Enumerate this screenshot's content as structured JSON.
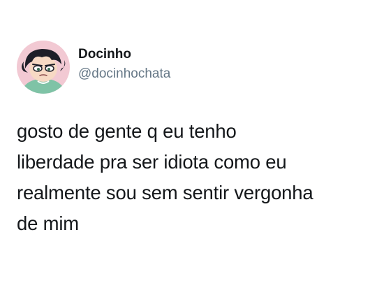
{
  "author": {
    "display_name": "Docinho",
    "handle": "@docinhochata",
    "avatar_icon": "cartoon-girl-avatar"
  },
  "tweet": {
    "lines": [
      "gosto de gente q eu tenho",
      "liberdade pra ser idiota como eu",
      "realmente sou sem sentir vergonha",
      "de mim"
    ]
  },
  "colors": {
    "background": "#ffffff",
    "text": "#14171a",
    "handle": "#657786"
  }
}
